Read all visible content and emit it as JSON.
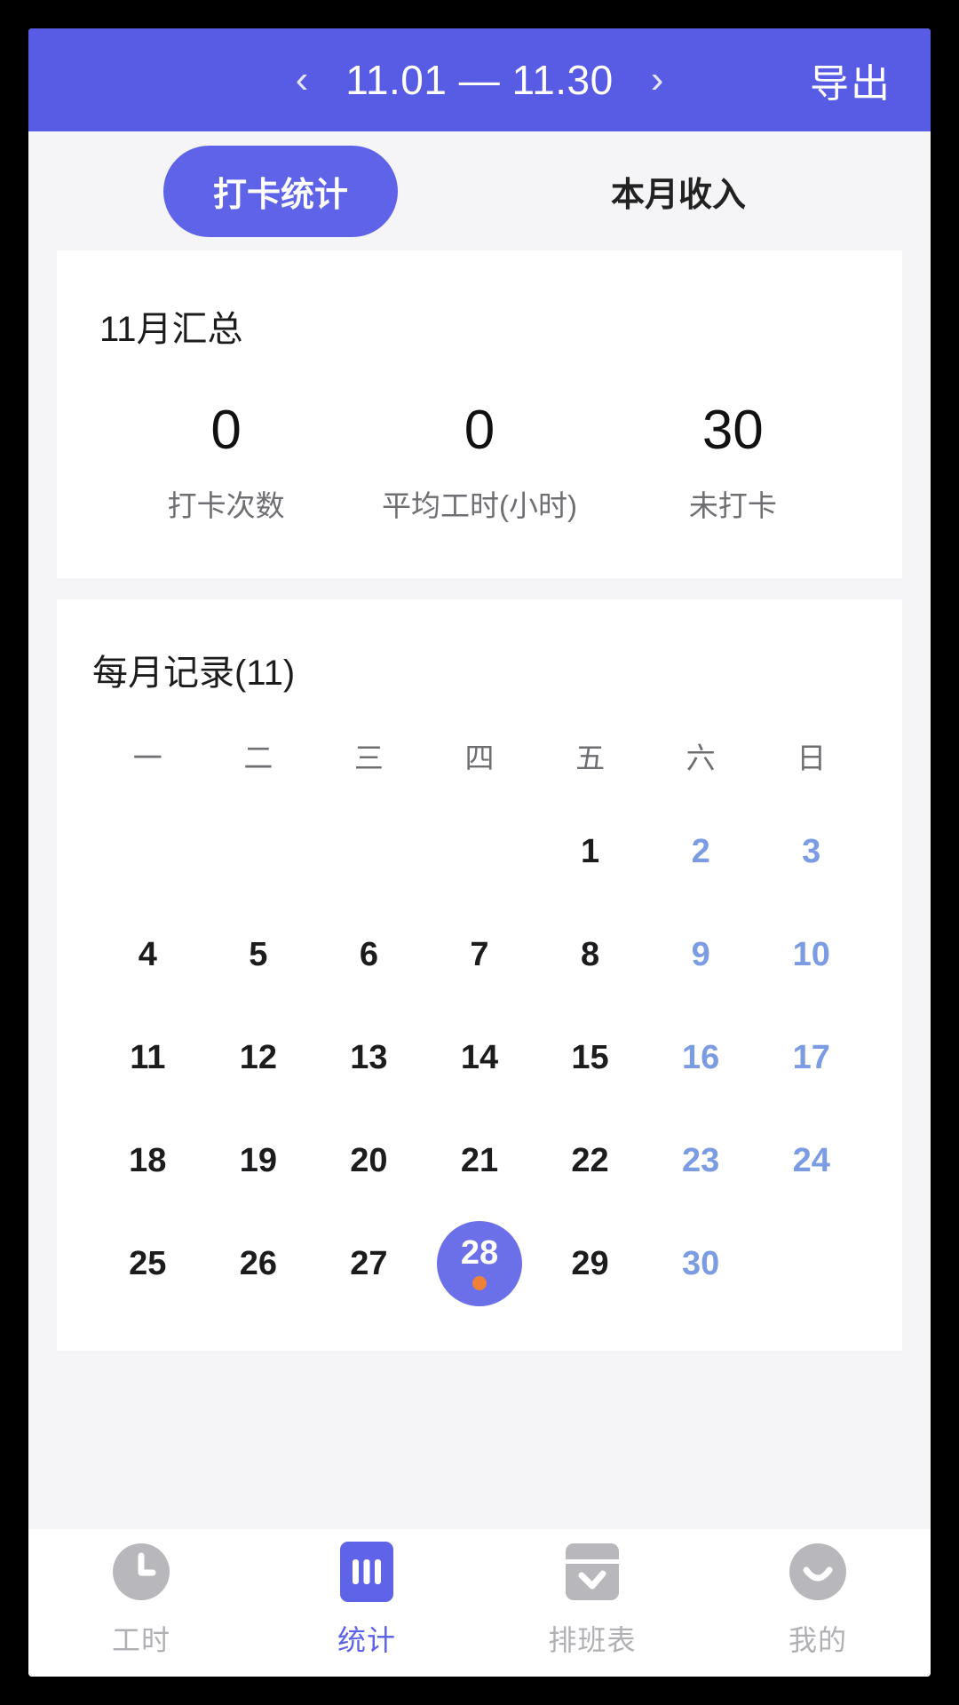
{
  "header": {
    "prev_icon": "chevron-left-icon",
    "date_range": "11.01 — 11.30",
    "next_icon": "chevron-right-icon",
    "export_label": "导出",
    "background_color": "#585ce5"
  },
  "tabs": [
    {
      "label": "打卡统计",
      "active": true
    },
    {
      "label": "本月收入",
      "active": false
    }
  ],
  "summary_card": {
    "title": "11月汇总",
    "stats": [
      {
        "value": "0",
        "label": "打卡次数"
      },
      {
        "value": "0",
        "label": "平均工时(小时)"
      },
      {
        "value": "30",
        "label": "未打卡"
      }
    ]
  },
  "calendar_card": {
    "title": "每月记录(11)",
    "weekdays": [
      "一",
      "二",
      "三",
      "四",
      "五",
      "六",
      "日"
    ],
    "leading_blanks": 4,
    "days": [
      {
        "n": "1",
        "weekend": false,
        "selected": false
      },
      {
        "n": "2",
        "weekend": true,
        "selected": false
      },
      {
        "n": "3",
        "weekend": true,
        "selected": false
      },
      {
        "n": "4",
        "weekend": false,
        "selected": false
      },
      {
        "n": "5",
        "weekend": false,
        "selected": false
      },
      {
        "n": "6",
        "weekend": false,
        "selected": false
      },
      {
        "n": "7",
        "weekend": false,
        "selected": false
      },
      {
        "n": "8",
        "weekend": false,
        "selected": false
      },
      {
        "n": "9",
        "weekend": true,
        "selected": false
      },
      {
        "n": "10",
        "weekend": true,
        "selected": false
      },
      {
        "n": "11",
        "weekend": false,
        "selected": false
      },
      {
        "n": "12",
        "weekend": false,
        "selected": false
      },
      {
        "n": "13",
        "weekend": false,
        "selected": false
      },
      {
        "n": "14",
        "weekend": false,
        "selected": false
      },
      {
        "n": "15",
        "weekend": false,
        "selected": false
      },
      {
        "n": "16",
        "weekend": true,
        "selected": false
      },
      {
        "n": "17",
        "weekend": true,
        "selected": false
      },
      {
        "n": "18",
        "weekend": false,
        "selected": false
      },
      {
        "n": "19",
        "weekend": false,
        "selected": false
      },
      {
        "n": "20",
        "weekend": false,
        "selected": false
      },
      {
        "n": "21",
        "weekend": false,
        "selected": false
      },
      {
        "n": "22",
        "weekend": false,
        "selected": false
      },
      {
        "n": "23",
        "weekend": true,
        "selected": false
      },
      {
        "n": "24",
        "weekend": true,
        "selected": false
      },
      {
        "n": "25",
        "weekend": false,
        "selected": false
      },
      {
        "n": "26",
        "weekend": false,
        "selected": false
      },
      {
        "n": "27",
        "weekend": false,
        "selected": false
      },
      {
        "n": "28",
        "weekend": false,
        "selected": true
      },
      {
        "n": "29",
        "weekend": false,
        "selected": false
      },
      {
        "n": "30",
        "weekend": true,
        "selected": false
      }
    ],
    "selected_color": "#6c70e8",
    "marker_dot_color": "#ef8038",
    "weekend_color": "#7b9be3"
  },
  "bottom_nav": [
    {
      "label": "工时",
      "icon": "clock-icon",
      "active": false
    },
    {
      "label": "统计",
      "icon": "bar-chart-icon",
      "active": true
    },
    {
      "label": "排班表",
      "icon": "schedule-icon",
      "active": false
    },
    {
      "label": "我的",
      "icon": "smiley-icon",
      "active": false
    }
  ],
  "accent_color": "#5f63e8"
}
